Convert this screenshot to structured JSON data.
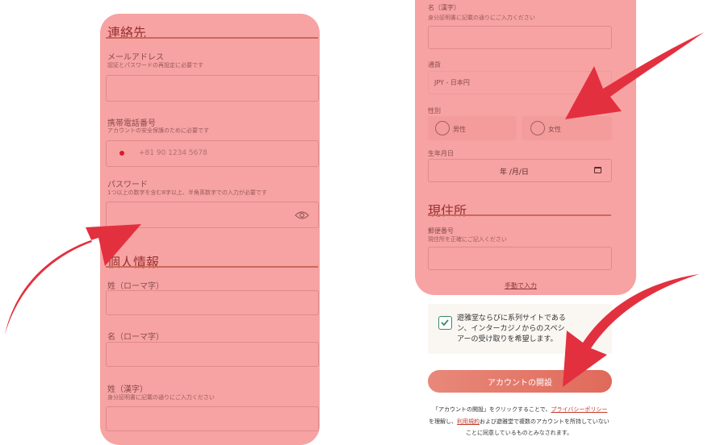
{
  "contact": {
    "title": "連絡先",
    "email_label": "メールアドレス",
    "email_hint": "認証とパスワードの再設定に必要です",
    "phone_label": "携帯電話番号",
    "phone_hint": "アカウントの安全保護のために必要です",
    "phone_placeholder": "+81 90 1234 5678",
    "password_label": "パスワード",
    "password_hint": "1つ以上の数字を含む8字以上、半角英数字での入力が必要です"
  },
  "personal": {
    "title": "個人情報",
    "last_name_roman_label": "姓（ローマ字）",
    "first_name_roman_label": "名（ローマ字）",
    "last_name_kanji_label": "姓（漢字）",
    "last_name_kanji_hint": "身分証明書に記載の通りにご入力ください",
    "first_name_kanji_label": "名（漢字）",
    "first_name_kanji_hint": "身分証明書に記載の通りにご入力ください",
    "currency_label": "通貨",
    "currency_value": "JPY - 日本円",
    "gender_label": "性別",
    "gender_options": [
      "男性",
      "女性"
    ],
    "birthdate_label": "生年月日",
    "birthdate_placeholder": "年 /月/日"
  },
  "address": {
    "title": "現住所",
    "postal_label": "郵便番号",
    "postal_hint": "現住所を正確にご記入ください",
    "manual_link": "手動で入力"
  },
  "consent": {
    "line1": "遊雅堂ならびに系列サイトである",
    "line2": "ン、インターカジノからのスペシ",
    "line3": "アーの受け取りを希望します。"
  },
  "open_account_button": "アカウントの開設",
  "footer": {
    "part1": "「アカウントの開設」をクリックすることで、",
    "privacy_link": "プライバシーポリシー",
    "part2": "を理解し、",
    "terms_link": "利用規約",
    "part3": "および遊雅堂で複数のアカウントを所持していない",
    "part4": "ことに同意しているものとみなされます。"
  },
  "colors": {
    "highlight": "#f7a3a3",
    "arrow": "#e3303f",
    "button": "#e57a6b"
  }
}
